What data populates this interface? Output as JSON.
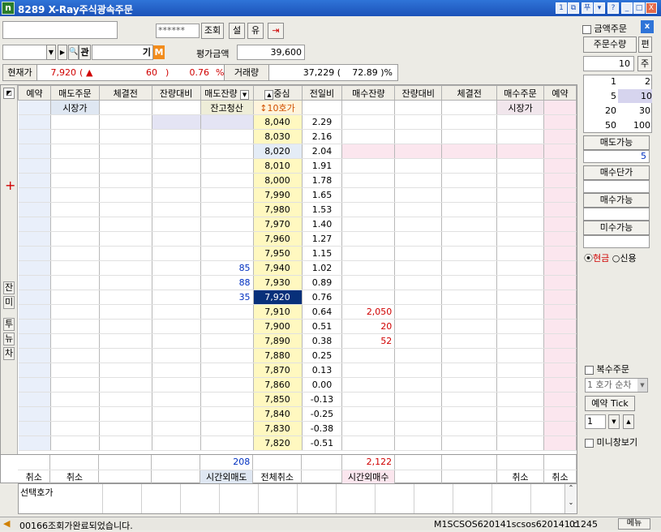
{
  "window": {
    "code": "8289",
    "title": "X-Ray주식광속주문"
  },
  "titlebar_buttons": [
    "1",
    "다",
    "푸",
    "폴",
    "?",
    "_",
    "□",
    "X"
  ],
  "toolbar": {
    "password": "******",
    "query": "조회",
    "settings": "설",
    "extra": "유",
    "icon_label": "관",
    "account_prefix": "기",
    "m_label": "M",
    "eval_label": "평가금액",
    "eval_value": "39,600"
  },
  "price_bar": {
    "current_label": "현재가",
    "current": "7,920",
    "paren_open": "(",
    "arrow": "▲",
    "change": "60",
    "paren_close": ")",
    "change_pct": "0.76",
    "pct": "%",
    "volume_label": "거래량",
    "volume": "37,229 (",
    "volume_pct": "72.89 )%"
  },
  "headers": [
    "예약",
    "매도주문",
    "체결전",
    "잔량대비",
    "매도잔량",
    "중심",
    "전일비",
    "매수잔량",
    "잔량대비",
    "체결전",
    "매수주문",
    "예약"
  ],
  "subheaders": {
    "sell_market": "시장가",
    "clear": "잔고청산",
    "ten": "↕10호가",
    "buy_market": "시장가"
  },
  "rows": [
    {
      "price": "8,040",
      "pct": "2.29",
      "sell": "",
      "buy": ""
    },
    {
      "price": "8,030",
      "pct": "2.16",
      "sell": "",
      "buy": ""
    },
    {
      "price": "8,020",
      "pct": "2.04",
      "sell": "",
      "buy": ""
    },
    {
      "price": "8,010",
      "pct": "1.91",
      "sell": "",
      "buy": ""
    },
    {
      "price": "8,000",
      "pct": "1.78",
      "sell": "",
      "buy": ""
    },
    {
      "price": "7,990",
      "pct": "1.65",
      "sell": "",
      "buy": ""
    },
    {
      "price": "7,980",
      "pct": "1.53",
      "sell": "",
      "buy": ""
    },
    {
      "price": "7,970",
      "pct": "1.40",
      "sell": "",
      "buy": ""
    },
    {
      "price": "7,960",
      "pct": "1.27",
      "sell": "",
      "buy": ""
    },
    {
      "price": "7,950",
      "pct": "1.15",
      "sell": "",
      "buy": ""
    },
    {
      "price": "7,940",
      "pct": "1.02",
      "sell": "85",
      "buy": ""
    },
    {
      "price": "7,930",
      "pct": "0.89",
      "sell": "88",
      "buy": ""
    },
    {
      "price": "7,920",
      "pct": "0.76",
      "sell": "35",
      "buy": ""
    },
    {
      "price": "7,910",
      "pct": "0.64",
      "sell": "",
      "buy": "2,050"
    },
    {
      "price": "7,900",
      "pct": "0.51",
      "sell": "",
      "buy": "20"
    },
    {
      "price": "7,890",
      "pct": "0.38",
      "sell": "",
      "buy": "52"
    },
    {
      "price": "7,880",
      "pct": "0.25",
      "sell": "",
      "buy": ""
    },
    {
      "price": "7,870",
      "pct": "0.13",
      "sell": "",
      "buy": ""
    },
    {
      "price": "7,860",
      "pct": "0.00",
      "sell": "",
      "buy": ""
    },
    {
      "price": "7,850",
      "pct": "-0.13",
      "sell": "",
      "buy": ""
    },
    {
      "price": "7,840",
      "pct": "-0.25",
      "sell": "",
      "buy": ""
    },
    {
      "price": "7,830",
      "pct": "-0.38",
      "sell": "",
      "buy": ""
    },
    {
      "price": "7,820",
      "pct": "-0.51",
      "sell": "",
      "buy": ""
    }
  ],
  "totals": {
    "sell_total": "208",
    "buy_total": "2,122"
  },
  "footer": {
    "cancel1": "취소",
    "cancel2": "취소",
    "after_sell": "시간외매도",
    "cancel_all": "전체취소",
    "after_buy": "시간외매수",
    "cancel3": "취소",
    "cancel4": "취소",
    "selected": "선택호가"
  },
  "left_buttons": [
    "잔",
    "미",
    "투",
    "뉴",
    "차"
  ],
  "right_panel": {
    "amount_order": "금액주문",
    "qty_label": "주문수량",
    "edit": "편",
    "qty": "10",
    "unit": "주",
    "qty_grid": [
      [
        "1",
        "2"
      ],
      [
        "5",
        "10"
      ],
      [
        "20",
        "30"
      ],
      [
        "50",
        "100"
      ]
    ],
    "sell_avail": "매도가능",
    "sell_avail_val": "5",
    "buy_price": "매수단가",
    "buy_avail": "매수가능",
    "unbuy_avail": "미수가능",
    "cash": "현금",
    "credit": "신용",
    "multi": "복수주문",
    "hoga": "1 호가 순차",
    "reserve_tick": "예약 Tick",
    "tick_val": "1",
    "mini": "미니창보기"
  },
  "status": {
    "message": "00166조회가완료되었습니다.",
    "screen": "M1SCSOS620141scsos620141.c",
    "code": "01245",
    "menu": "메뉴"
  }
}
